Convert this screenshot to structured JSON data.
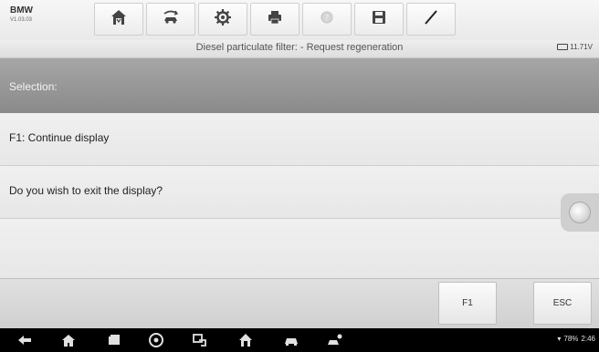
{
  "toolbar": {
    "app_name": "BMW",
    "app_version": "V1.03.03",
    "buttons": [
      {
        "name": "home-icon"
      },
      {
        "name": "vehicle-swap-icon"
      },
      {
        "name": "settings-gear-icon"
      },
      {
        "name": "print-icon"
      },
      {
        "name": "help-icon"
      },
      {
        "name": "save-icon"
      },
      {
        "name": "pen-icon"
      }
    ]
  },
  "title_strip": {
    "title": "Diesel particulate filter: - Request regeneration",
    "battery_voltage": "11.71V"
  },
  "content": {
    "section_label": "Selection:",
    "rows": [
      {
        "text": "F1: Continue display"
      },
      {
        "text": "Do you wish to exit the display?"
      },
      {
        "text": ""
      }
    ]
  },
  "function_keys": {
    "f1_label": "F1",
    "esc_label": "ESC"
  },
  "nav_bar": {
    "battery_percent": "78%",
    "time": "2:46"
  },
  "colors": {
    "selection_bar": "#9a9a9a",
    "row_bg": "#ececec",
    "nav_bg": "#000000"
  }
}
